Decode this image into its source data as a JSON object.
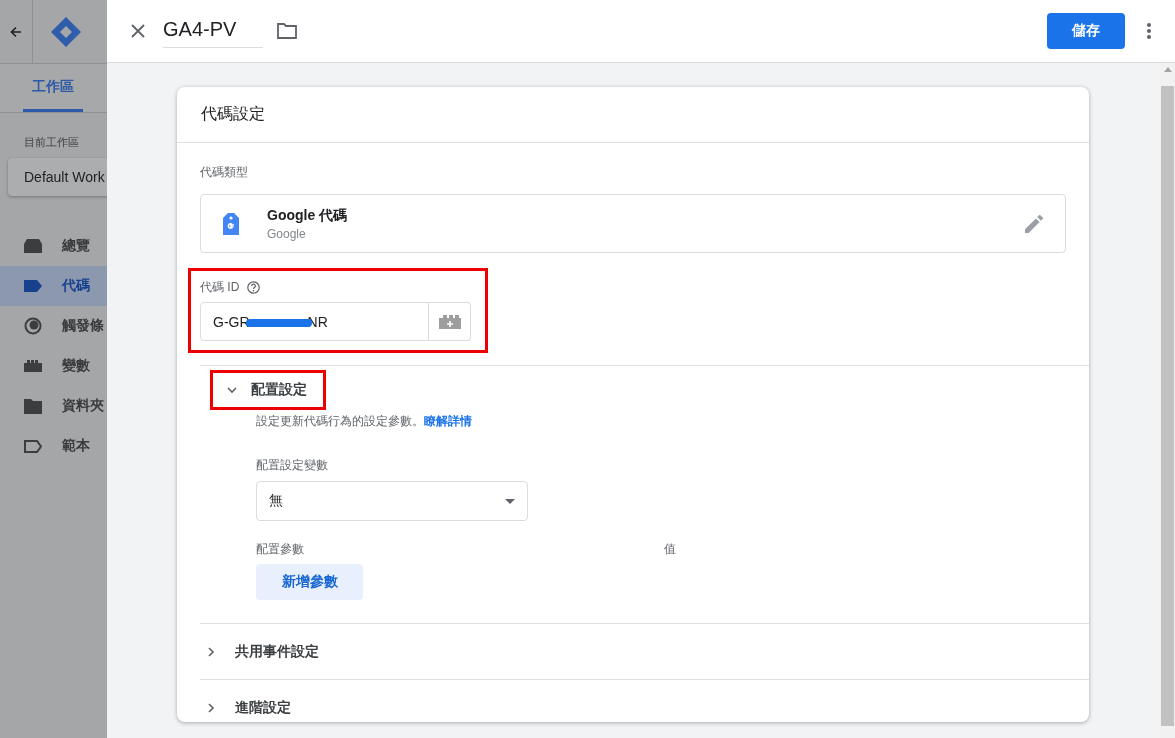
{
  "sidebar": {
    "tabs": [
      {
        "label": "工作區",
        "selected": true
      }
    ],
    "workspace_label": "目前工作區",
    "workspace": "Default Work",
    "items": [
      {
        "label": "總覽",
        "kind": "overview",
        "selected": false
      },
      {
        "label": "代碼",
        "kind": "tag",
        "selected": true
      },
      {
        "label": "觸發條",
        "kind": "trigger",
        "selected": false
      },
      {
        "label": "變數",
        "kind": "variable",
        "selected": false
      },
      {
        "label": "資料夾",
        "kind": "folder",
        "selected": false
      },
      {
        "label": "範本",
        "kind": "template",
        "selected": false
      }
    ]
  },
  "header": {
    "name": "GA4-PV",
    "save": "儲存"
  },
  "card": {
    "title": "代碼設定",
    "tag_type": {
      "label": "代碼類型",
      "name": "Google 代碼",
      "vendor": "Google"
    },
    "tag_id": {
      "label": "代碼 ID",
      "value_start": "G-GR",
      "value_end": "NR",
      "redacted": true,
      "highlighted": true
    },
    "sections": [
      {
        "title": "配置設定",
        "expanded": true,
        "highlighted": true,
        "description": "設定更新代碼行為的設定參數。",
        "link": "瞭解詳情",
        "variable_label": "配置設定變數",
        "variable_value": "無",
        "param_label": "配置參數",
        "value_label": "值",
        "add_button": "新增參數"
      },
      {
        "title": "共用事件設定",
        "expanded": false
      },
      {
        "title": "進階設定",
        "expanded": false
      }
    ]
  }
}
